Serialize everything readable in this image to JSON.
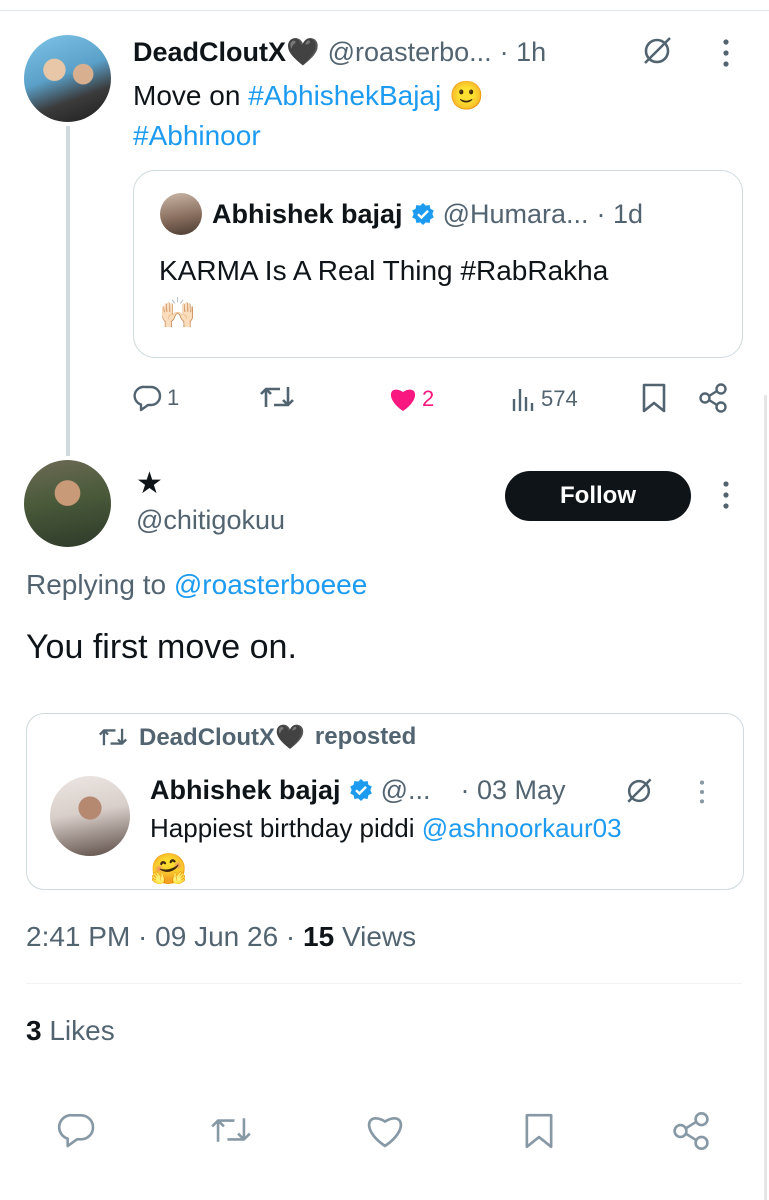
{
  "colors": {
    "accent": "#1d9bf0",
    "like": "#f91880",
    "muted": "#536471",
    "text": "#0f1419"
  },
  "parent_tweet": {
    "name": "DeadCloutX🖤",
    "handle": "@roasterbo...",
    "time": "· 1h",
    "text": "Move on",
    "hashtag1": "#AbhishekBajaj",
    "emoji": "🙂",
    "hashtag2": "#Abhinoor",
    "quote": {
      "name": "Abhishek bajaj",
      "handle": "@Humara...",
      "time": "· 1d",
      "text": "KARMA Is A Real Thing #RabRakha",
      "emoji": "🙌🏻"
    },
    "actions": {
      "replies": "1",
      "likes": "2",
      "views": "574"
    }
  },
  "reply_tweet": {
    "name": "★",
    "handle": "@chitigokuu",
    "follow_label": "Follow",
    "replying_prefix": "Replying to",
    "replying_handle": "@roasterboeee",
    "text": "You first move on.",
    "quote": {
      "repost_label": "DeadCloutX🖤",
      "repost_suffix": "reposted",
      "name": "Abhishek bajaj",
      "handle": "@...",
      "time": "· 03 May",
      "text": "Happiest birthday piddi",
      "mention": "@ashnoorkaur03",
      "emoji": "🤗"
    },
    "meta": {
      "time": "2:41 PM · 09 Jun 26 ·",
      "views_count": "15",
      "views_label": "Views"
    },
    "likes": {
      "count": "3",
      "label": "Likes"
    }
  },
  "icons": [
    "reply-icon",
    "retweet-icon",
    "heart-icon",
    "views-icon",
    "bookmark-icon",
    "share-icon",
    "more-icon",
    "grok-icon",
    "verified-icon"
  ]
}
